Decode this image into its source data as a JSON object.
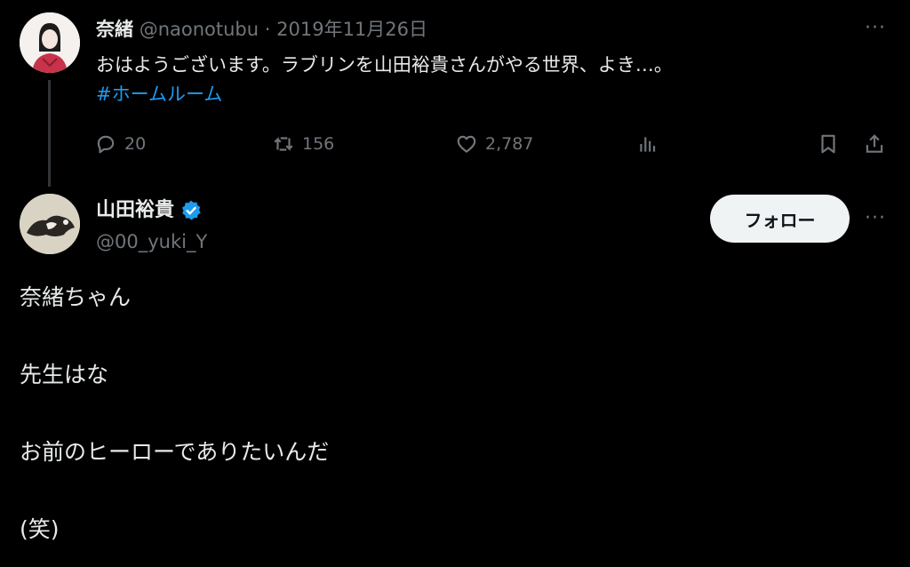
{
  "parent_tweet": {
    "author_name": "奈緒",
    "handle": "@naonotubu",
    "separator": "·",
    "date": "2019年11月26日",
    "text": "おはようございます。ラブリンを山田裕貴さんがやる世界、よき…。",
    "hashtag": "#ホームルーム",
    "more_label": "···",
    "actions": {
      "reply_count": "20",
      "retweet_count": "156",
      "like_count": "2,787"
    }
  },
  "main_tweet": {
    "author_name": "山田裕貴",
    "handle": "@00_yuki_Y",
    "verified": true,
    "follow_label": "フォロー",
    "more_label": "···",
    "lines": [
      "奈緒ちゃん",
      "先生はな",
      "お前のヒーローでありたいんだ",
      "(笑)"
    ]
  },
  "colors": {
    "background": "#000000",
    "text": "#e7e9ea",
    "muted": "#71767b",
    "link": "#1d9bf0",
    "verified": "#1d9bf0",
    "follow_bg": "#eff3f4"
  },
  "icons": [
    "reply-icon",
    "retweet-icon",
    "like-icon",
    "views-icon",
    "bookmark-icon",
    "share-icon",
    "verified-badge-icon",
    "more-icon"
  ]
}
